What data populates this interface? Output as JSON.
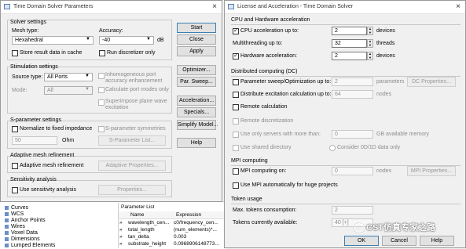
{
  "tdsp": {
    "title": "Time Domain Solver Parameters",
    "solver_settings": "Solver settings",
    "mesh_type_label": "Mesh type:",
    "mesh_type_value": "Hexahedral",
    "accuracy_label": "Accuracy:",
    "accuracy_value": "-40",
    "accuracy_unit": "dB",
    "store_result": "Store result data in cache",
    "run_discretizer": "Run discretizer only",
    "stimulation_settings": "Stimulation settings",
    "source_type_label": "Source type:",
    "source_type_value": "All Ports",
    "mode_label": "Mode:",
    "mode_value": "All",
    "inhomogeneous_port": "Inhomogeneous port accuracy enhancement",
    "calc_port_modes": "Calculate port modes only",
    "superimpose": "Superimpose plane wave excitation",
    "sparam_settings": "S-parameter settings",
    "normalize": "Normalize to fixed impedance",
    "sparam_symmetries": "S-parameter symmetries",
    "impedance_value": "50",
    "impedance_unit": "Ohm",
    "sparam_list": "S-Parameter List...",
    "adaptive_mesh": "Adaptive mesh refinement",
    "adaptive_mesh_cb": "Adaptive mesh refinement",
    "adaptive_props": "Adaptive Properties...",
    "sensitivity": "Sensitivity analysis",
    "sensitivity_cb": "Use sensitivity analysis",
    "properties": "Properties...",
    "buttons": {
      "start": "Start",
      "close": "Close",
      "apply": "Apply",
      "optimizer": "Optimizer...",
      "par_sweep": "Par. Sweep...",
      "acceleration": "Acceleration...",
      "specials": "Specials...",
      "simplify": "Simplify Model...",
      "help": "Help"
    }
  },
  "tree": [
    "Curves",
    "WCS",
    "Anchor Points",
    "Wires",
    "Voxel Data",
    "Dimensions",
    "Lumped Elements"
  ],
  "param_list": {
    "title": "Parameter List",
    "col_name": "Name",
    "col_expr": "Expression",
    "rows": [
      {
        "name": "wavelength_cen...",
        "expr": "c0/frequency_cen..."
      },
      {
        "name": "total_length",
        "expr": "(num_elements)*..."
      },
      {
        "name": "tan_delta",
        "expr": "0.003"
      },
      {
        "name": "substrate_height",
        "expr": "0.0968906148773..."
      }
    ]
  },
  "lic": {
    "title": "License and Acceleration - Time Domain Solver",
    "cpu_section": "CPU and Hardware acceleration",
    "cpu_accel": "CPU acceleration up to:",
    "cpu_accel_value": "2",
    "cpu_accel_unit": "devices",
    "multithreading": "Multithreading up to:",
    "multithreading_value": "32",
    "multithreading_unit": "threads",
    "hw_accel": "Hardware acceleration:",
    "hw_accel_value": "2",
    "hw_accel_unit": "devices",
    "dc_section": "Distributed computing (DC)",
    "param_sweep": "Parameter sweep/Optimization up to:",
    "param_sweep_value": "2",
    "param_sweep_unit": "parameters",
    "dc_props_1": "DC Properties...",
    "distribute_excitation": "Distribute excitation calculation up to:",
    "distribute_value": "64",
    "distribute_unit": "nodes",
    "remote_calc": "Remote calculation",
    "remote_discretization": "Remote discretization",
    "use_servers": "Use only servers with more than:",
    "use_servers_value": "0",
    "use_servers_unit": "GB available memory",
    "use_shared": "Use shared directory",
    "consider_0d1d": "Consider 0D/1D data only",
    "mpi_section": "MPI computing",
    "mpi_on": "MPI computing on:",
    "mpi_value": "0",
    "mpi_unit": "nodes",
    "mpi_props": "MPI Properties...",
    "mpi_auto": "Use MPI automatically for huge projects",
    "token_section": "Token usage",
    "max_tokens": "Max. tokens consumption:",
    "max_tokens_value": "2",
    "tokens_available": "Tokens currently available:",
    "tokens_available_value": "40 [+]",
    "ok": "OK",
    "cancel": "Cancel",
    "help": "Help"
  },
  "watermark": "CST仿真专家之路"
}
